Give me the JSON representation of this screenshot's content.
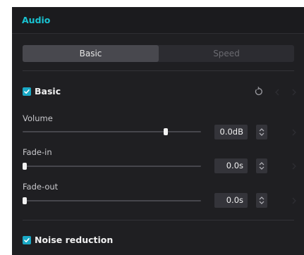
{
  "header": {
    "title": "Audio"
  },
  "tabs": [
    {
      "label": "Basic",
      "active": true
    },
    {
      "label": "Speed",
      "active": false
    }
  ],
  "basic_section": {
    "label": "Basic",
    "checked": true,
    "reset_icon": "reset-icon",
    "controls": [
      {
        "label": "Volume",
        "value": "0.0dB",
        "slider_fraction": 0.81
      },
      {
        "label": "Fade-in",
        "value": "0.0s",
        "slider_fraction": 0.0
      },
      {
        "label": "Fade-out",
        "value": "0.0s",
        "slider_fraction": 0.0
      }
    ]
  },
  "noise_section": {
    "label": "Noise reduction",
    "checked": true
  },
  "colors": {
    "accent": "#19c3d2",
    "checkbox": "#1aa9c6",
    "panel_bg": "#1f1f22"
  }
}
